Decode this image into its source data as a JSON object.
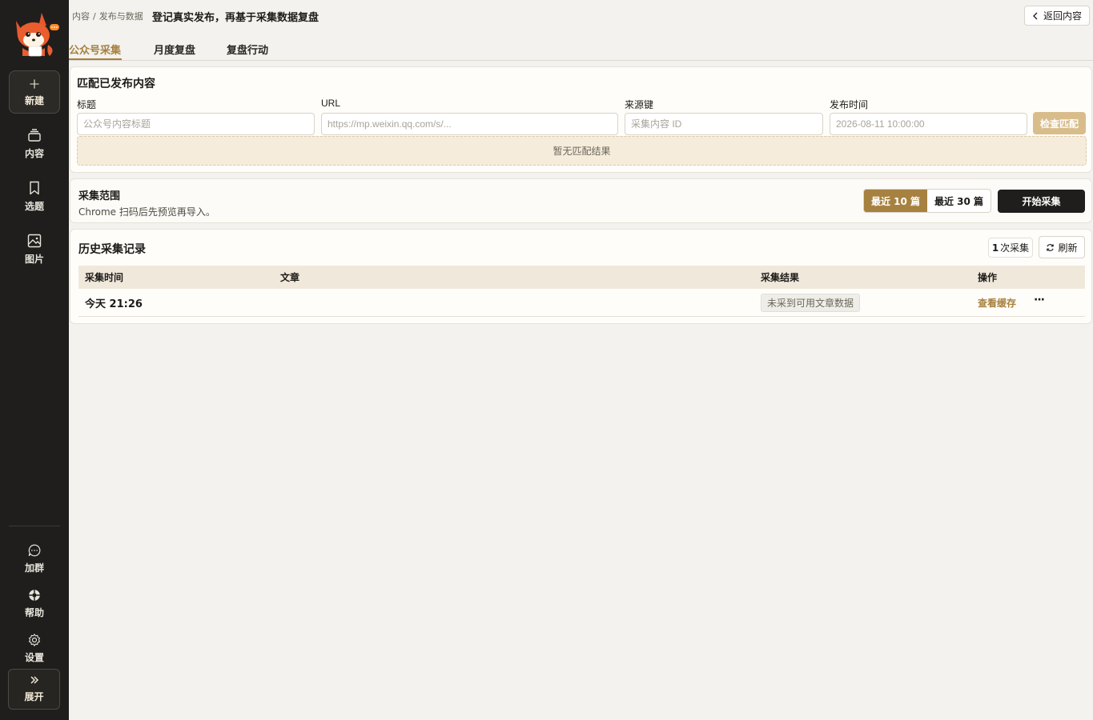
{
  "sidebar": {
    "new_label": "新建",
    "items": [
      {
        "label": "内容",
        "icon": "layers-icon"
      },
      {
        "label": "选题",
        "icon": "bookmark-icon"
      },
      {
        "label": "图片",
        "icon": "image-icon"
      }
    ],
    "bottom_items": [
      {
        "label": "加群",
        "icon": "chat-icon"
      },
      {
        "label": "帮助",
        "icon": "help-icon"
      },
      {
        "label": "设置",
        "icon": "gear-icon"
      }
    ],
    "expand_label": "展开",
    "logo_icon": "fox-logo-icon"
  },
  "header": {
    "breadcrumb": [
      "内容",
      "发布与数据"
    ],
    "breadcrumb_sep": "/",
    "title": "登记真实发布，再基于采集数据复盘",
    "back_label": "返回内容"
  },
  "tabs": [
    {
      "label": "公众号采集",
      "active": true
    },
    {
      "label": "月度复盘",
      "active": false
    },
    {
      "label": "复盘行动",
      "active": false
    }
  ],
  "match": {
    "title": "匹配已发布内容",
    "fields": [
      {
        "label": "标题",
        "placeholder": "公众号内容标题"
      },
      {
        "label": "URL",
        "placeholder": "https://mp.weixin.qq.com/s/..."
      },
      {
        "label": "来源键",
        "placeholder": "采集内容 ID"
      },
      {
        "label": "发布时间",
        "placeholder": "2026-08-11 10:00:00"
      }
    ],
    "check_label": "检查匹配",
    "empty_text": "暂无匹配结果"
  },
  "scope": {
    "title": "采集范围",
    "desc": "Chrome 扫码后先预览再导入。",
    "options": [
      {
        "label": "最近 10 篇",
        "selected": true
      },
      {
        "label": "最近 30 篇",
        "selected": false
      }
    ],
    "start_label": "开始采集"
  },
  "history": {
    "title": "历史采集记录",
    "count": "1",
    "count_suffix": "次采集",
    "refresh_label": "刷新",
    "columns": [
      "采集时间",
      "文章",
      "采集结果",
      "操作"
    ],
    "rows": [
      {
        "time": "今天 21:26",
        "article": "",
        "result": "未采到可用文章数据",
        "action": "查看缓存",
        "more": "···"
      }
    ]
  },
  "colors": {
    "accent": "#a6813f",
    "sidebar_bg": "#1f1e1c",
    "dark_button": "#1f1e1c"
  }
}
